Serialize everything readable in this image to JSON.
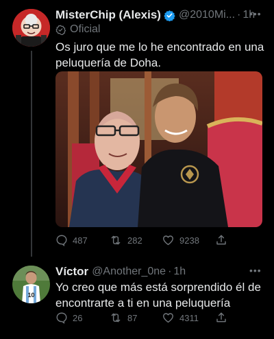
{
  "tweet": {
    "display_name": "MisterChip (Alexis)",
    "handle": "@2010Mi...",
    "separator": "·",
    "time": "1h",
    "label": "Oficial",
    "text_line1": "Os juro que me lo he encontrado en una",
    "text_line2": "peluquería de Doha.",
    "replies": "487",
    "retweets": "282",
    "likes": "9238"
  },
  "reply": {
    "display_name": "Víctor",
    "handle": "@Another_0ne",
    "separator": "·",
    "time": "1h",
    "text_line1": "Yo creo que más está sorprendido él de",
    "text_line2": "encontrarte a ti en una peluquería",
    "replies": "26",
    "retweets": "87",
    "likes": "4311"
  },
  "icons": {
    "verified": "verified-badge-icon",
    "more": "more-icon",
    "reply": "reply-icon",
    "retweet": "retweet-icon",
    "like": "heart-icon",
    "share": "share-icon"
  },
  "colors": {
    "background": "#000000",
    "text": "#e7e9ea",
    "muted": "#71767b",
    "verified": "#1d9bf0"
  }
}
